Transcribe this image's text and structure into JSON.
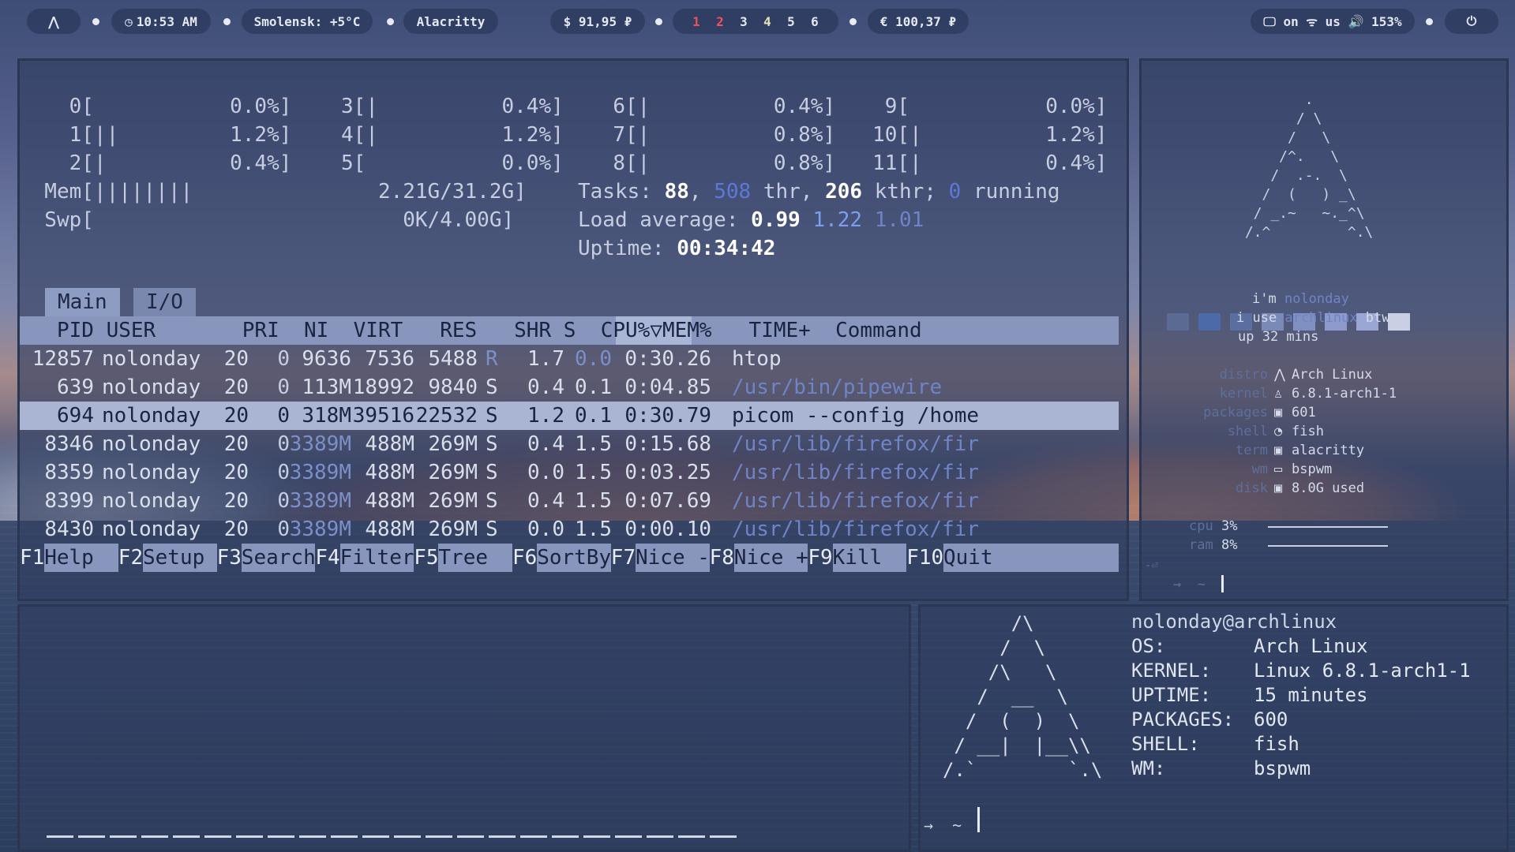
{
  "topbar": {
    "arch_glyph": "⋀",
    "clock_icon": "clock-icon",
    "time": "10:53 AM",
    "weather": "Smolensk: +5°C",
    "window": "Alacritty",
    "usd": "$ 91,95 ₽",
    "workspaces": [
      "1",
      "2",
      "3",
      "4",
      "5",
      "6"
    ],
    "eur": "€ 100,37 ₽",
    "status": "🖵 on ᯤ us 🔊 153%",
    "power_glyph": "⏻"
  },
  "htop": {
    "cpu_rows": [
      "    0[           0.0%]    3[|          0.4%]    6[|          0.4%]    9[           0.0%]",
      "    1[||         1.2%]    4[|          1.2%]    7[|          0.8%]   10[|          1.2%]",
      "    2[|          0.4%]    5[           0.0%]    8[|          0.8%]   11[|          0.4%]"
    ],
    "mem": "  Mem[||||||||               2.21G/31.2G]",
    "swp": "  Swp[                         0K/4.00G]",
    "tasks_label": "Tasks: ",
    "tasks": "88",
    "thr": "508",
    "thr_label": " thr, ",
    "kthr": "206",
    "kthr_label": " kthr; ",
    "running": "0",
    "running_label": " running",
    "load_label": "Load average: ",
    "load1": "0.99",
    "load5": "1.22",
    "load15": "1.01",
    "uptime_label": "Uptime: ",
    "uptime": "00:34:42",
    "tab_main": "Main",
    "tab_io": "I/O",
    "header": "   PID USER       PRI  NI  VIRT   RES   SHR S  CPU%▽MEM%   TIME+  Command",
    "processes": [
      {
        "pid": "12857",
        "user": "nolonday",
        "pri": "20",
        "ni": "0",
        "virt": "9636",
        "res": "7536",
        "shr": "5488",
        "s": "R",
        "cpu": "1.7",
        "mem": "0.0",
        "time": "0:30.26",
        "cmd": "htop"
      },
      {
        "pid": "639",
        "user": "nolonday",
        "pri": "20",
        "ni": "0",
        "virt": "113M",
        "res": "18992",
        "shr": "9840",
        "s": "S",
        "cpu": "0.4",
        "mem": "0.1",
        "time": "0:04.85",
        "cmd": "/usr/bin/pipewire"
      },
      {
        "pid": "694",
        "user": "nolonday",
        "pri": "20",
        "ni": "0",
        "virt": "318M",
        "res": "39516",
        "shr": "22532",
        "s": "S",
        "cpu": "1.2",
        "mem": "0.1",
        "time": "0:30.79",
        "cmd": "picom --config /home"
      },
      {
        "pid": "8346",
        "user": "nolonday",
        "pri": "20",
        "ni": "0",
        "virt": "3389M",
        "res": "488M",
        "shr": "269M",
        "s": "S",
        "cpu": "0.4",
        "mem": "1.5",
        "time": "0:15.68",
        "cmd": "/usr/lib/firefox/fir"
      },
      {
        "pid": "8359",
        "user": "nolonday",
        "pri": "20",
        "ni": "0",
        "virt": "3389M",
        "res": "488M",
        "shr": "269M",
        "s": "S",
        "cpu": "0.0",
        "mem": "1.5",
        "time": "0:03.25",
        "cmd": "/usr/lib/firefox/fir"
      },
      {
        "pid": "8399",
        "user": "nolonday",
        "pri": "20",
        "ni": "0",
        "virt": "3389M",
        "res": "488M",
        "shr": "269M",
        "s": "S",
        "cpu": "0.4",
        "mem": "1.5",
        "time": "0:07.69",
        "cmd": "/usr/lib/firefox/fir"
      },
      {
        "pid": "8430",
        "user": "nolonday",
        "pri": "20",
        "ni": "0",
        "virt": "3389M",
        "res": "488M",
        "shr": "269M",
        "s": "S",
        "cpu": "0.0",
        "mem": "1.5",
        "time": "0:00.10",
        "cmd": "/usr/lib/firefox/fir"
      }
    ],
    "fkeys": [
      {
        "key": "F1",
        "label": "Help  "
      },
      {
        "key": "F2",
        "label": "Setup "
      },
      {
        "key": "F3",
        "label": "Search"
      },
      {
        "key": "F4",
        "label": "Filter"
      },
      {
        "key": "F5",
        "label": "Tree  "
      },
      {
        "key": "F6",
        "label": "SortBy"
      },
      {
        "key": "F7",
        "label": "Nice -"
      },
      {
        "key": "F8",
        "label": "Nice +"
      },
      {
        "key": "F9",
        "label": "Kill  "
      },
      {
        "key": "F10",
        "label": "Quit  "
      }
    ]
  },
  "neofetch_small": {
    "logo": "        .\n       / \\\n      /   \\\n     /^.   \\\n    /  .-.  \\\n   /  (   ) _\\\n  / _.~   ~._^\\\n /.^         ^.\\",
    "swatch_colors": [
      "#5a6a92",
      "#4d6aa8",
      "#5a6fa0",
      "#7a8ab8",
      "#8090c0",
      "#8d9acb",
      "#9aa6d4",
      "#c9d0e4"
    ],
    "im": "i'm ",
    "user": "nolonday",
    "i_use": "i use ",
    "distro_word": "archlinux",
    "btw": " btw",
    "up": "up 32 mins",
    "info": [
      {
        "label": "distro",
        "icon": "⋀",
        "value": "Arch Linux"
      },
      {
        "label": "kernel",
        "icon": "♙",
        "value": "6.8.1-arch1-1"
      },
      {
        "label": "packages",
        "icon": "▣",
        "value": "601"
      },
      {
        "label": "shell",
        "icon": "◔",
        "value": "fish"
      },
      {
        "label": "term",
        "icon": "▣",
        "value": "alacritty"
      },
      {
        "label": "wm",
        "icon": "▭",
        "value": "bspwm"
      },
      {
        "label": "disk",
        "icon": "▣",
        "value": "8.0G used"
      }
    ],
    "cpu_label": "cpu",
    "cpu_val": "3%",
    "ram_label": "ram",
    "ram_val": "8%",
    "prompt_hint": "-⏎",
    "prompt": "→  ~ "
  },
  "fetch": {
    "logo": "      /\\\n     /  \\\n    /\\   \\\n   /  __  \\\n  /  (  )  \\\n / __|  |__\\\\\n/.`        `.\\",
    "title": "nolonday@archlinux",
    "rows": [
      {
        "k": "OS:",
        "v": "Arch Linux"
      },
      {
        "k": "KERNEL:",
        "v": "Linux 6.8.1-arch1-1"
      },
      {
        "k": "UPTIME:",
        "v": "15 minutes"
      },
      {
        "k": "PACKAGES:",
        "v": "600"
      },
      {
        "k": "SHELL:",
        "v": "fish"
      },
      {
        "k": "WM:",
        "v": "bspwm"
      }
    ],
    "prompt": "→  ~ "
  }
}
